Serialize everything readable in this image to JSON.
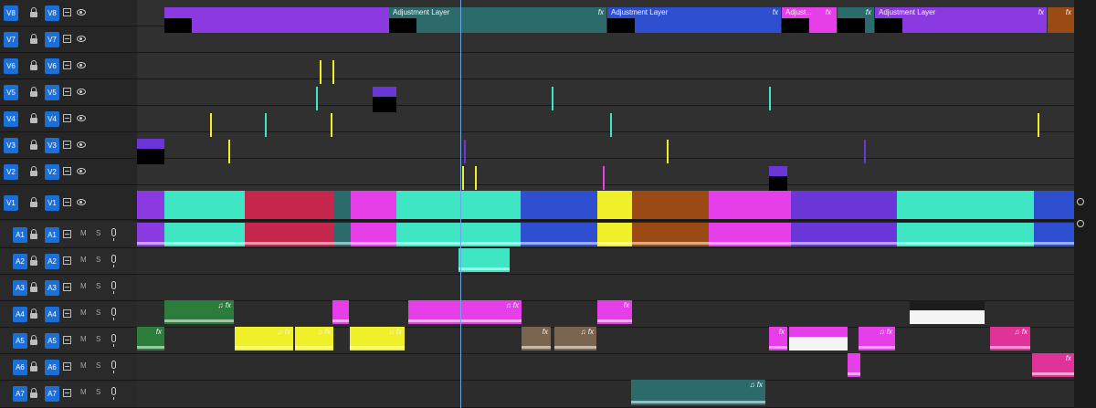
{
  "tracks": [
    {
      "target": "V8",
      "label": "V8",
      "kind": "video"
    },
    {
      "target": "V7",
      "label": "V7",
      "kind": "video"
    },
    {
      "target": "V6",
      "label": "V6",
      "kind": "video"
    },
    {
      "target": "V5",
      "label": "V5",
      "kind": "video"
    },
    {
      "target": "V4",
      "label": "V4",
      "kind": "video"
    },
    {
      "target": "V3",
      "label": "V3",
      "kind": "video"
    },
    {
      "target": "V2",
      "label": "V2",
      "kind": "video"
    },
    {
      "target": "V1",
      "label": "V1",
      "kind": "video"
    },
    {
      "target": "A1",
      "label": "A1",
      "kind": "audio"
    },
    {
      "target": "A2",
      "label": "A2",
      "kind": "audio"
    },
    {
      "target": "A3",
      "label": "A3",
      "kind": "audio"
    },
    {
      "target": "A4",
      "label": "A4",
      "kind": "audio"
    },
    {
      "target": "A5",
      "label": "A5",
      "kind": "audio"
    },
    {
      "target": "A6",
      "label": "A6",
      "kind": "audio"
    },
    {
      "target": "A7",
      "label": "A7",
      "kind": "audio"
    }
  ],
  "audio_buttons": {
    "mute": "M",
    "solo": "S"
  },
  "clip_labels": {
    "adjustment_layer": "Adjustment Layer",
    "adjustment_short": "Adjust...",
    "fx": "fx",
    "audio_fx": "♫ fx",
    "audio_fx_alt": "♫ fx"
  },
  "colors": {
    "target_blue": "#1c6fd6",
    "violet": "#8a3ae0",
    "teal": "#2b6b6b",
    "aqua": "#3fe6c3",
    "magenta": "#e63ee8",
    "crimson": "#c4264c",
    "blue": "#2e4fd0",
    "yellow": "#f0f02a",
    "orange": "#9a4a12",
    "green": "#2c7d3c",
    "tan": "#7a6550",
    "white": "#f4f4f4",
    "pink": "#e0339a"
  }
}
